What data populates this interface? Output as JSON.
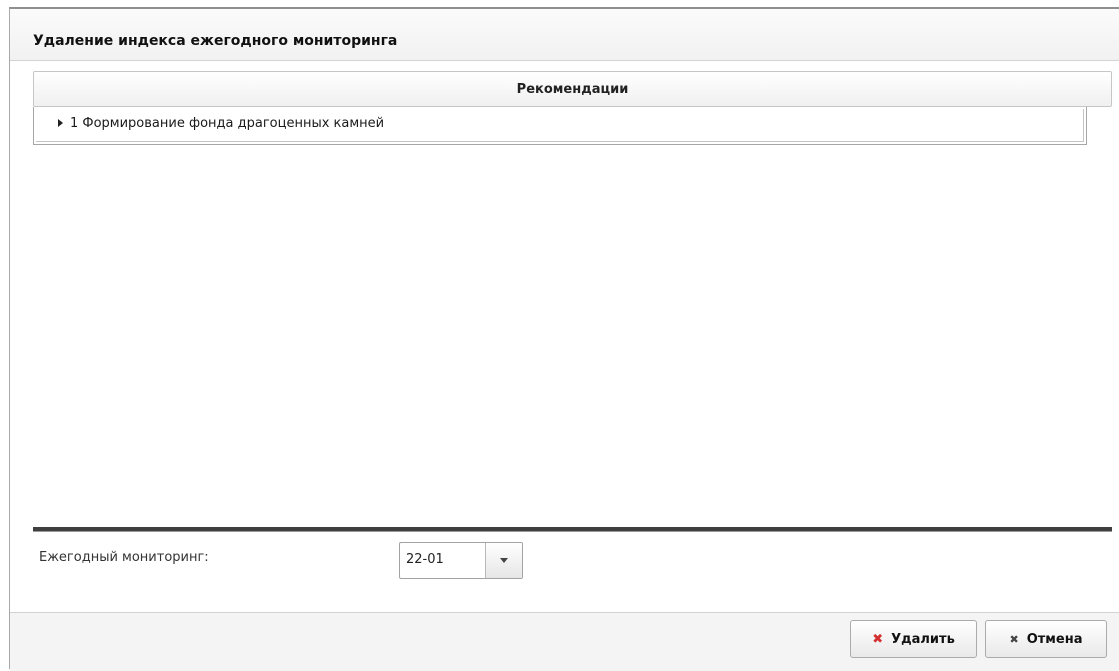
{
  "dialog": {
    "title": "Удаление индекса ежегодного мониторинга"
  },
  "grid": {
    "column_header": "Рекомендации",
    "rows": [
      {
        "text": "1 Формирование фонда драгоценных камней"
      }
    ]
  },
  "form": {
    "monitoring_label": "Ежегодный мониторинг:",
    "monitoring_value": "22-01"
  },
  "buttons": {
    "delete_label": "Удалить",
    "cancel_label": "Отмена"
  },
  "colors": {
    "delete_icon": "#d32f2f",
    "splitter": "#3f3f3f"
  }
}
